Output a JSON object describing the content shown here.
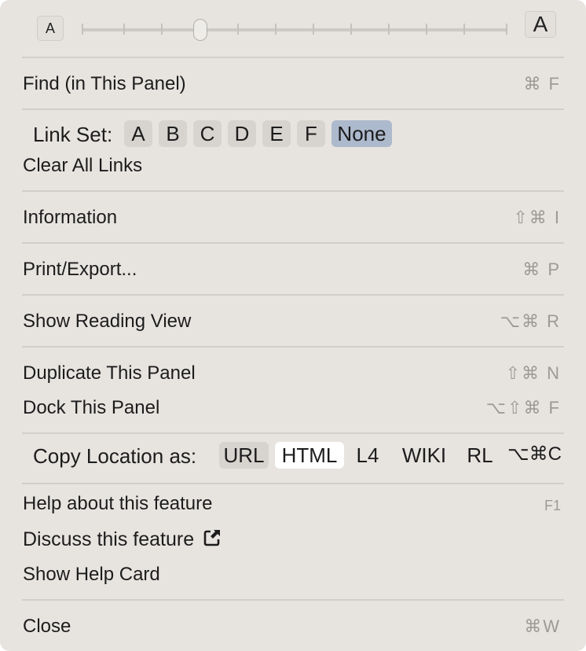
{
  "font_size": {
    "small_label": "A",
    "large_label": "A",
    "slider_level": 0.28
  },
  "menu": {
    "find": {
      "label": "Find (in This Panel)",
      "shortcut": "⌘ F"
    },
    "link_set": {
      "label": "Link Set:",
      "options": [
        "A",
        "B",
        "C",
        "D",
        "E",
        "F",
        "None"
      ],
      "selected": "None"
    },
    "clear_links": {
      "label": "Clear All Links"
    },
    "information": {
      "label": "Information",
      "shortcut": "⇧⌘ I"
    },
    "print_export": {
      "label": "Print/Export...",
      "shortcut": "⌘ P"
    },
    "reading_view": {
      "label": "Show Reading View",
      "shortcut": "⌥⌘ R"
    },
    "duplicate": {
      "label": "Duplicate This Panel",
      "shortcut": "⇧⌘ N"
    },
    "dock": {
      "label": "Dock This Panel",
      "shortcut": "⌥⇧⌘ F"
    },
    "copy_location": {
      "label": "Copy Location as:",
      "options": [
        "URL",
        "HTML",
        "L4",
        "WIKI",
        "RL"
      ],
      "shortcut": "⌥⌘C"
    },
    "help_feature": {
      "label": "Help about this feature",
      "shortcut": "F1"
    },
    "discuss_feature": {
      "label": "Discuss this feature",
      "icon": "external-link-icon"
    },
    "help_card": {
      "label": "Show Help Card"
    },
    "close": {
      "label": "Close",
      "shortcut": "⌘W"
    }
  }
}
